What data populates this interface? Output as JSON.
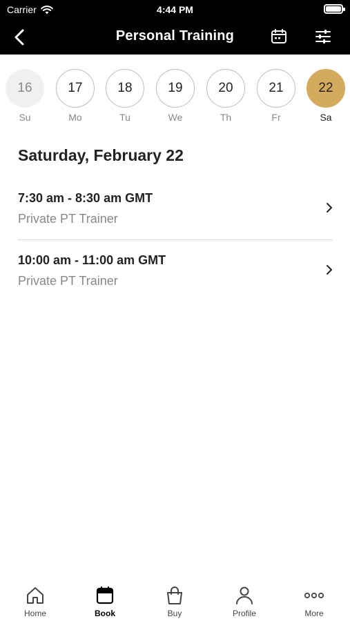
{
  "status_bar": {
    "carrier": "Carrier",
    "time": "4:44 PM"
  },
  "nav": {
    "title": "Personal Training",
    "icons": [
      "chevron-left-icon",
      "calendar-icon",
      "sliders-icon"
    ]
  },
  "date_strip": {
    "days": [
      {
        "number": "16",
        "weekday": "Su",
        "state": "past"
      },
      {
        "number": "17",
        "weekday": "Mo",
        "state": "default"
      },
      {
        "number": "18",
        "weekday": "Tu",
        "state": "default"
      },
      {
        "number": "19",
        "weekday": "We",
        "state": "default"
      },
      {
        "number": "20",
        "weekday": "Th",
        "state": "default"
      },
      {
        "number": "21",
        "weekday": "Fr",
        "state": "default"
      },
      {
        "number": "22",
        "weekday": "Sa",
        "state": "selected"
      }
    ]
  },
  "selected_date_label": "Saturday, February 22",
  "sessions": [
    {
      "time": "7:30 am - 8:30 am GMT",
      "trainer": "Private PT Trainer"
    },
    {
      "time": "10:00 am - 11:00 am GMT",
      "trainer": "Private PT Trainer"
    }
  ],
  "tab_bar": {
    "tabs": [
      {
        "label": "Home",
        "icon": "house-icon",
        "active": false
      },
      {
        "label": "Book",
        "icon": "calendar-icon",
        "active": true
      },
      {
        "label": "Buy",
        "icon": "shopping-bag-icon",
        "active": false
      },
      {
        "label": "Profile",
        "icon": "person-icon",
        "active": false
      },
      {
        "label": "More",
        "icon": "ellipsis-icon",
        "active": false
      }
    ]
  },
  "colors": {
    "header_bg": "#000000",
    "accent": "#d4aa5e",
    "muted_text": "#888888"
  }
}
